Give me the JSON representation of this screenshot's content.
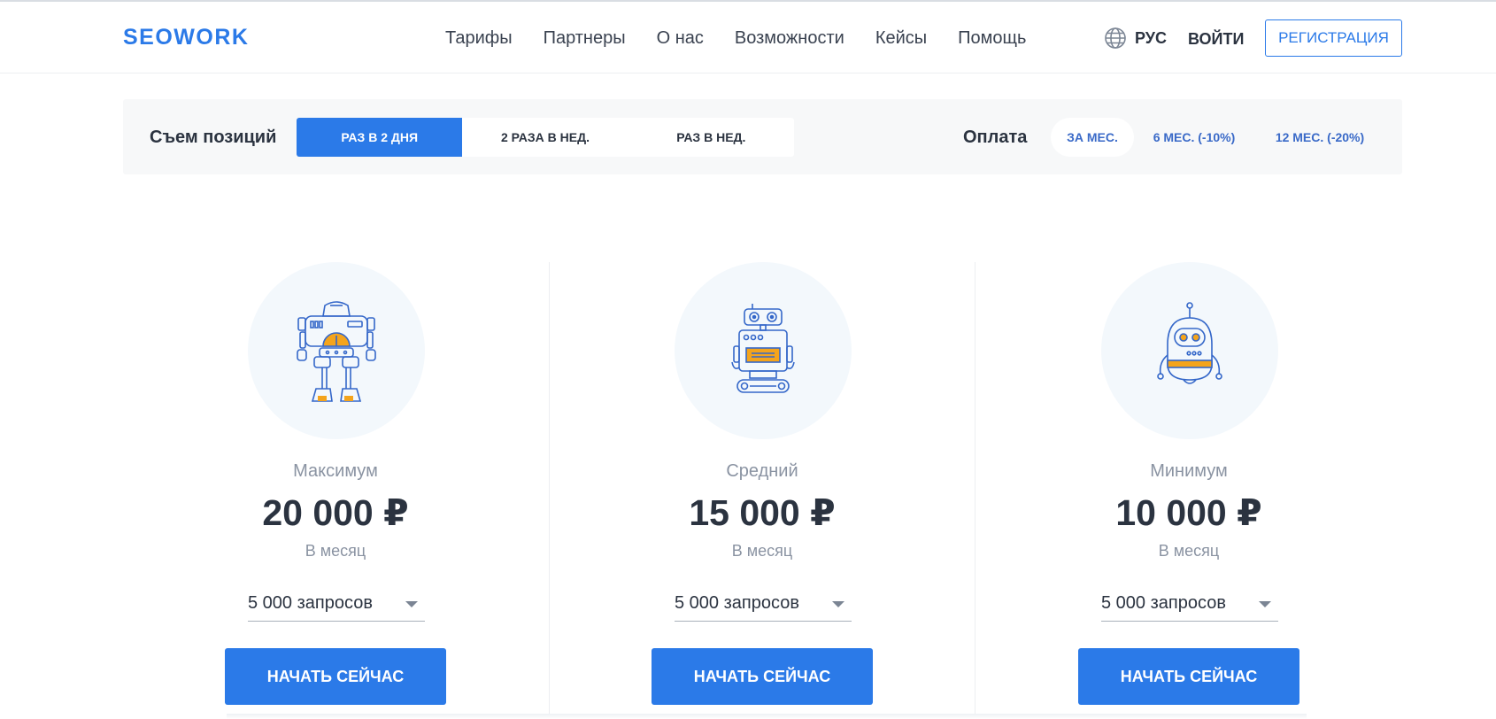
{
  "header": {
    "logo": "SEOWORK",
    "nav": [
      "Тарифы",
      "Партнеры",
      "О нас",
      "Возможности",
      "Кейсы",
      "Помощь"
    ],
    "language": "РУС",
    "login": "ВОЙТИ",
    "register": "РЕГИСТРАЦИЯ"
  },
  "filters": {
    "positions_label": "Съем позиций",
    "positions_options": [
      "РАЗ В 2 ДНЯ",
      "2 РАЗА В НЕД.",
      "РАЗ В НЕД."
    ],
    "positions_selected": "РАЗ В 2 ДНЯ",
    "payment_label": "Оплата",
    "payment_options": [
      "ЗА МЕС.",
      "6 МЕС. (-10%)",
      "12 МЕС. (-20%)"
    ],
    "payment_selected": "ЗА МЕС."
  },
  "plans": [
    {
      "name": "Максимум",
      "price": "20 000 ₽",
      "period": "В месяц",
      "requests": "5 000 запросов",
      "cta": "НАЧАТЬ СЕЙЧАС",
      "icon": "robot-max-icon"
    },
    {
      "name": "Средний",
      "price": "15 000 ₽",
      "period": "В месяц",
      "requests": "5 000 запросов",
      "cta": "НАЧАТЬ СЕЙЧАС",
      "icon": "robot-mid-icon"
    },
    {
      "name": "Минимум",
      "price": "10 000 ₽",
      "period": "В месяц",
      "requests": "5 000 запросов",
      "cta": "НАЧАТЬ СЕЙЧАС",
      "icon": "robot-min-icon"
    }
  ],
  "colors": {
    "accent": "#2b7ae8",
    "robot_fill": "#f4a41c",
    "robot_line": "#3467c9"
  }
}
